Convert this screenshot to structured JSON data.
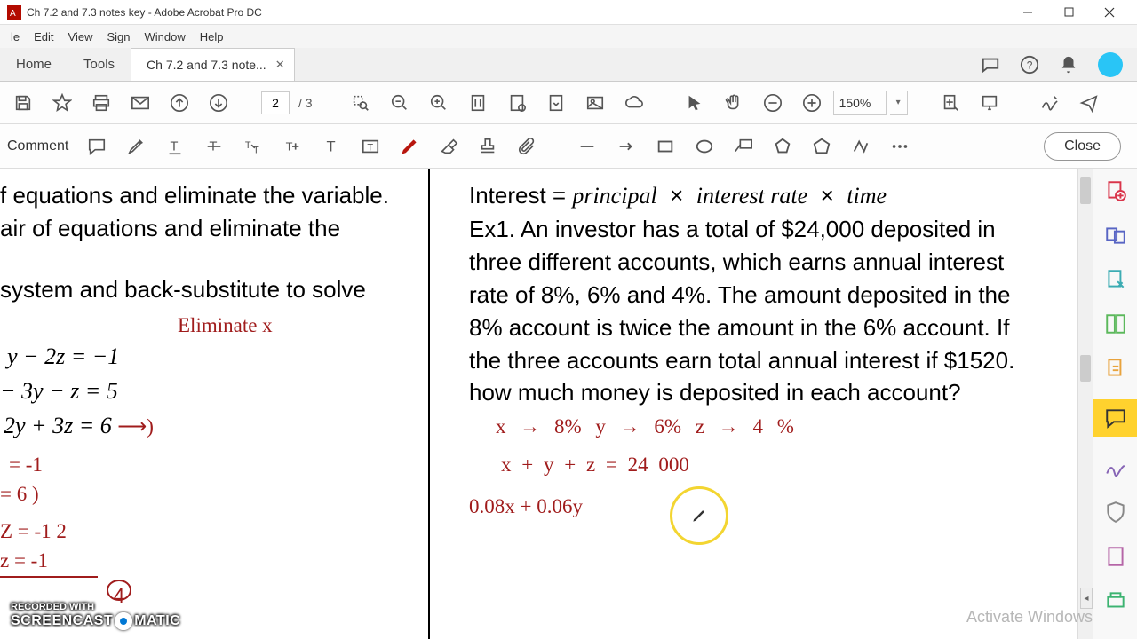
{
  "window": {
    "title": "Ch 7.2 and 7.3 notes key - Adobe Acrobat Pro DC"
  },
  "menu": {
    "file": "le",
    "edit": "Edit",
    "view": "View",
    "sign": "Sign",
    "window": "Window",
    "help": "Help"
  },
  "nav": {
    "home": "Home",
    "tools": "Tools",
    "doctab": "Ch 7.2 and 7.3 note..."
  },
  "toolbar": {
    "page_current": "2",
    "page_total": "/ 3",
    "zoom": "150%",
    "close": "Close",
    "comment": "Comment"
  },
  "document": {
    "left_line1": "f equations and eliminate the variable.",
    "left_line2": "air of equations and eliminate the",
    "left_line3": "system and back-substitute to solve",
    "left_hand1": "Eliminate x",
    "left_eq1": "y − 2z = −1",
    "left_eq2": "− 3y − z = 5",
    "left_eq3": "2y + 3z = 6",
    "left_hand2": "= -1",
    "left_hand3": "= 6 )",
    "left_hand4": "Z = -1 2",
    "left_hand5": "z = -1",
    "left_hand6": "4",
    "right_line1": "Interest = principal  ×  interest rate  ×  time",
    "right_line2": "Ex1. An investor has a total of $24,000 deposited in three different accounts, which earns annual interest rate of 8%, 6% and 4%. The amount deposited in the 8% account is twice the amount in the 6% account. If the three accounts earn total annual interest if $1520. how much money is deposited in each account?",
    "right_hand1": "x → 8%     y → 6%     z → 4 %",
    "right_hand2": "x + y + z = 24 000",
    "right_hand3": "0.08x + 0.06y"
  },
  "watermark": "Activate Windows",
  "recorder": {
    "line1": "RECORDED WITH",
    "line2": "SCREENCAST",
    "line3": "MATIC"
  }
}
